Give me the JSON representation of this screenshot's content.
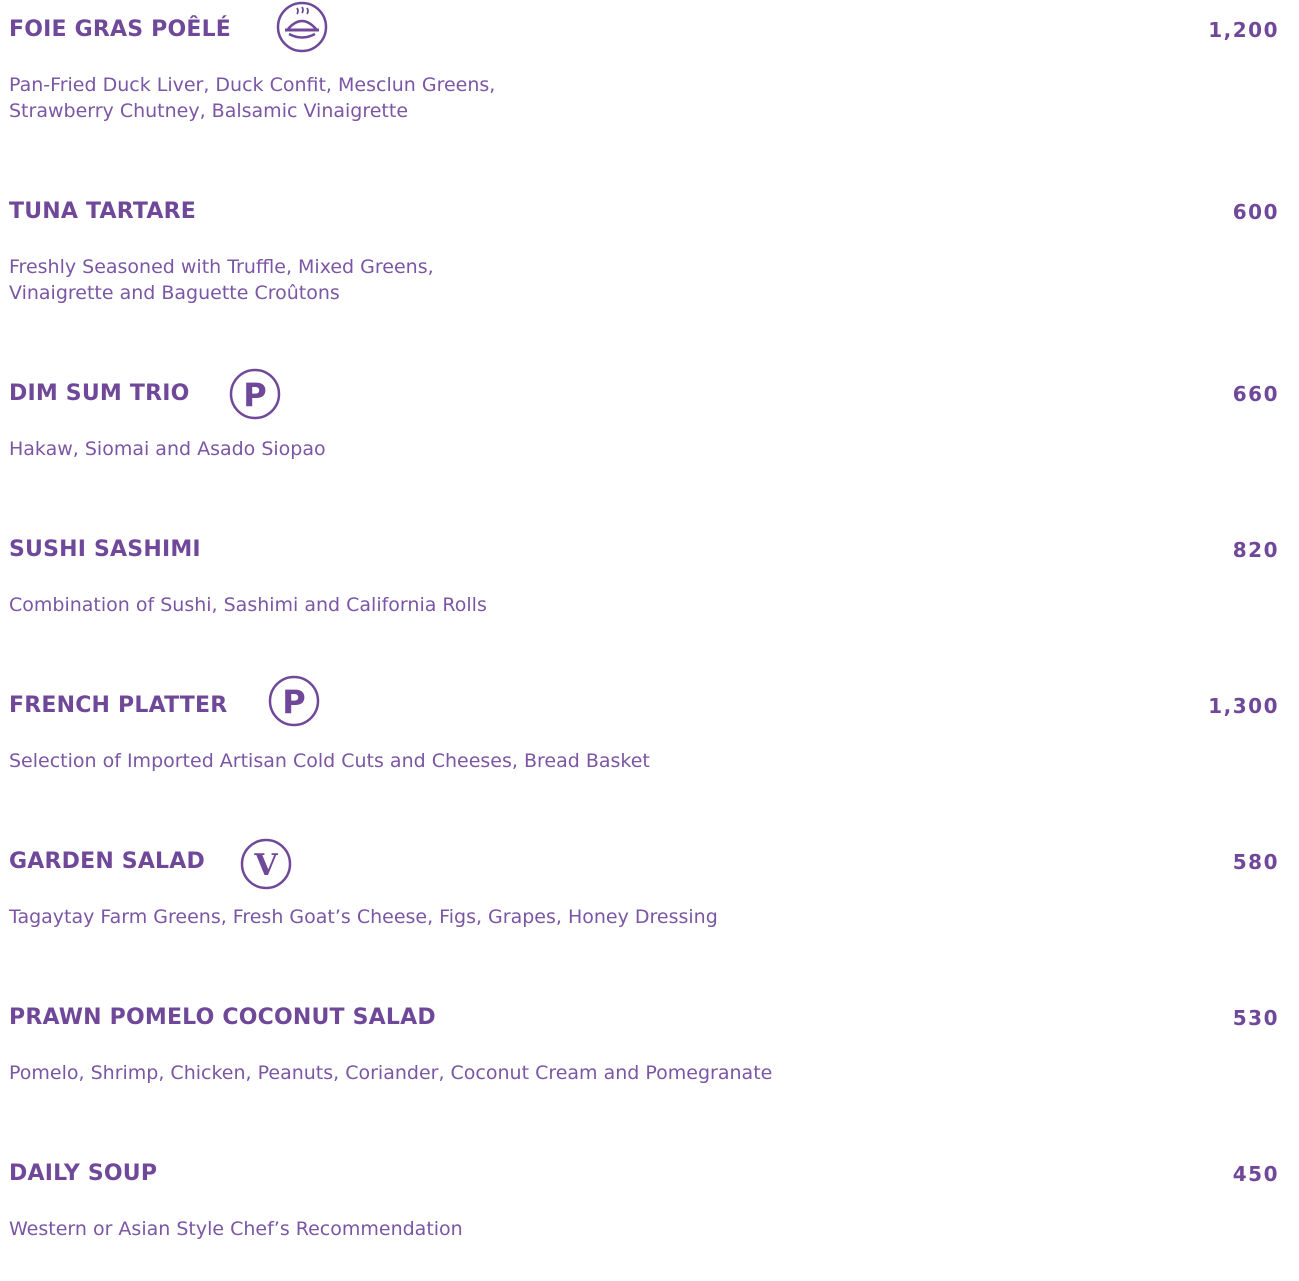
{
  "menu": {
    "items": [
      {
        "name": "FOIE GRAS POÊLÉ",
        "price": "1,200",
        "desc_line1": "Pan-Fried Duck Liver, Duck Confit, Mesclun Greens,",
        "desc_line2": "Strawberry Chutney, Balsamic Vinaigrette",
        "badge": "chef-signature-dish-icon"
      },
      {
        "name": "TUNA TARTARE",
        "price": "600",
        "desc_line1": "Freshly Seasoned with Truffle, Mixed Greens,",
        "desc_line2": "Vinaigrette and Baguette Croûtons"
      },
      {
        "name": "DIM SUM TRIO",
        "price": "660",
        "desc_line1": "Hakaw, Siomai and Asado Siopao",
        "badge": "pork-p-icon",
        "badge_text": "P"
      },
      {
        "name": "SUSHI SASHIMI",
        "price": "820",
        "desc_line1": "Combination of Sushi, Sashimi and California Rolls"
      },
      {
        "name": "FRENCH PLATTER",
        "price": "1,300",
        "desc_line1": "Selection of Imported Artisan Cold Cuts and Cheeses, Bread Basket",
        "badge": "pork-p-icon",
        "badge_text": "P"
      },
      {
        "name": "GARDEN SALAD",
        "price": "580",
        "desc_line1": "Tagaytay Farm Greens, Fresh Goat’s Cheese, Figs, Grapes, Honey Dressing",
        "badge": "vegetarian-v-icon",
        "badge_text": "V"
      },
      {
        "name": "PRAWN POMELO COCONUT SALAD",
        "price": "530",
        "desc_line1": "Pomelo, Shrimp, Chicken, Peanuts, Coriander, Coconut Cream and Pomegranate"
      },
      {
        "name": "DAILY SOUP",
        "price": "450",
        "desc_line1": "Western or Asian Style Chef’s Recommendation"
      }
    ]
  },
  "colors": {
    "accent": "#70489a"
  }
}
